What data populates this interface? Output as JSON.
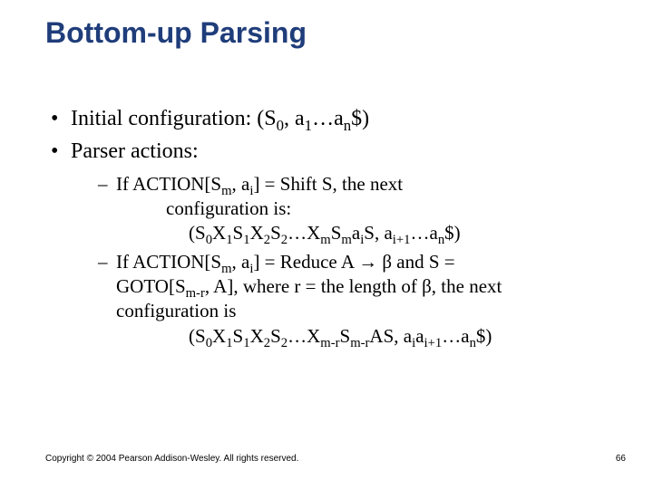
{
  "title": "Bottom-up Parsing",
  "bullets": {
    "b1_pre": "Initial configuration: (S",
    "b1_s0": "0",
    "b1_mid": ", a",
    "b1_s1": "1",
    "b1_mid2": "…a",
    "b1_sn": "n",
    "b1_post": "$)",
    "b2": "Parser actions:"
  },
  "sub1": {
    "l1a": "If ACTION[S",
    "l1a_sm": "m",
    "l1b": ", a",
    "l1b_si": "i",
    "l1c": "] = Shift S, the next",
    "l2": "configuration is:",
    "l3a": "(S",
    "l3_0": "0",
    "l3b": "X",
    "l3_1a": "1",
    "l3c": "S",
    "l3_1b": "1",
    "l3d": "X",
    "l3_2a": "2",
    "l3e": "S",
    "l3_2b": "2",
    "l3f": "…X",
    "l3_ma": "m",
    "l3g": "S",
    "l3_mb": "m",
    "l3h": "a",
    "l3_ia": "i",
    "l3i": "S, a",
    "l3_ip1": "i+1",
    "l3j": "…a",
    "l3_n": "n",
    "l3k": "$)"
  },
  "sub2": {
    "l1a": "If ACTION[S",
    "l1_sm": "m",
    "l1b": ", a",
    "l1_si": "i",
    "l1c": "] = Reduce A ",
    "arrow": "→",
    "l1d": " β and S =",
    "l2a": "GOTO[S",
    "l2_smr": "m-r",
    "l2b": ", A], where r = the length of β, the next",
    "l3": "configuration is",
    "l4a": "(S",
    "l4_0": "0",
    "l4b": "X",
    "l4_1a": "1",
    "l4c": "S",
    "l4_1b": "1",
    "l4d": "X",
    "l4_2a": "2",
    "l4e": "S",
    "l4_2b": "2",
    "l4f": "…X",
    "l4_mra": "m-r",
    "l4g": "S",
    "l4_mrb": "m-r",
    "l4h": "AS, a",
    "l4_ia": "i",
    "l4i": "a",
    "l4_ip1": "i+1",
    "l4j": "…a",
    "l4_n": "n",
    "l4k": "$)"
  },
  "footer": "Copyright © 2004 Pearson Addison-Wesley. All rights reserved.",
  "page": "66"
}
